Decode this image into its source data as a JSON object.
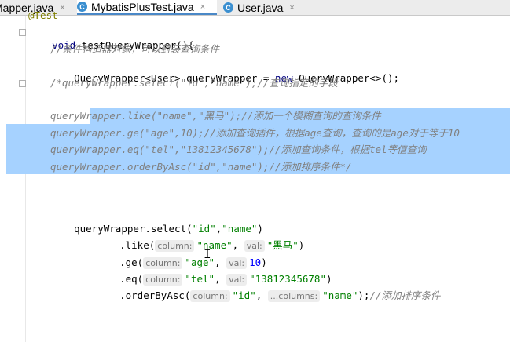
{
  "tabs": [
    {
      "label": "Mapper.java",
      "icon": "I",
      "active": false
    },
    {
      "label": "MybatisPlusTest.java",
      "icon": "C",
      "active": true
    },
    {
      "label": "User.java",
      "icon": "C",
      "active": false
    }
  ],
  "tab_close_glyph": "×",
  "code": {
    "annotation": "@Test",
    "method_kw": "void",
    "method_sig": " testQueryWrapper(){",
    "c1": "//条件构造器对象，可以封装查询条件",
    "l2_type": "QueryWrapper<User> queryWrapper = ",
    "l2_new": "new",
    "l2_rest": " QueryWrapper<>();",
    "c3": "/*queryWrapper.select(\"id\",\"name\");//查询指定的字段",
    "c5": "queryWrapper.like(\"name\",\"黑马\");//添加一个模糊查询的查询条件",
    "c6": "queryWrapper.ge(\"age\",10);//添加查询插件，根据age查询，查询的是age对于等于10",
    "c7": "queryWrapper.eq(\"tel\",\"13812345678\");//添加查询条件，根据tel等值查询",
    "c8": "queryWrapper.orderByAsc(\"id\",\"name\");//添加排序条件*/",
    "s1_a": "queryWrapper.select(",
    "s1_b": "\"id\"",
    "s1_c": ",",
    "s1_d": "\"name\"",
    "s1_e": ")",
    "like_a": ".like(",
    "like_h1": "column:",
    "like_v1": "\"name\"",
    "like_sep": ", ",
    "like_h2": "val:",
    "like_v2": "\"黑马\"",
    "like_e": ")",
    "ge_a": ".ge(",
    "ge_h1": "column:",
    "ge_v1": "\"age\"",
    "ge_sep": ", ",
    "ge_h2": "val:",
    "ge_v2": "10",
    "ge_e": ")",
    "eq_a": ".eq(",
    "eq_h1": "column:",
    "eq_v1": "\"tel\"",
    "eq_sep": ", ",
    "eq_h2": "val:",
    "eq_v2": "\"13812345678\"",
    "eq_e": ")",
    "ob_a": ".orderByAsc(",
    "ob_h1": "column:",
    "ob_v1": "\"id\"",
    "ob_sep": ", ",
    "ob_h2": "...columns:",
    "ob_v2": "\"name\"",
    "ob_e": ");",
    "ob_c": "//添加排序条件"
  },
  "colors": {
    "selection": "#a6d2ff",
    "keyword": "#000080",
    "string": "#008000",
    "number": "#0000ff",
    "comment": "#808080"
  }
}
